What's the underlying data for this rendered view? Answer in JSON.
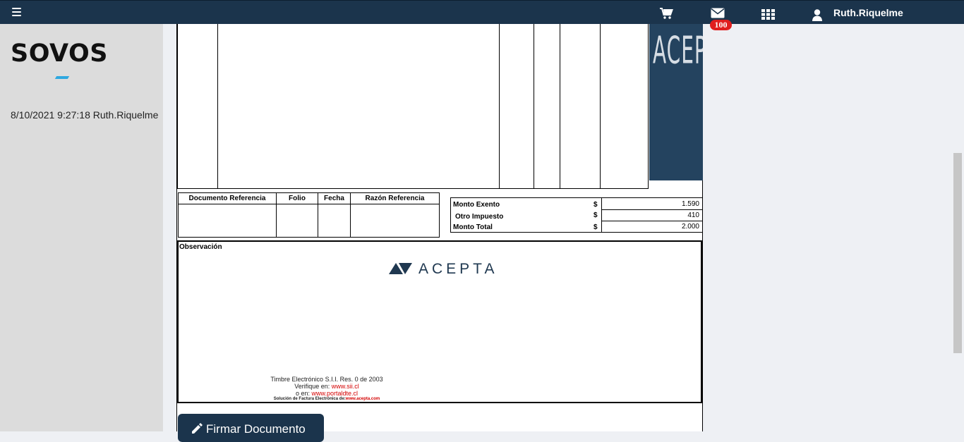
{
  "nav": {
    "user_name": "Ruth.Riquelme",
    "mail_count": "100",
    "icons": [
      "menu-icon",
      "cart-icon",
      "mail-icon",
      "apps-grid-icon",
      "user-icon"
    ]
  },
  "sidebar": {
    "logo": "SOVOS",
    "session_info": "8/10/2021 9:27:18 Ruth.Riquelme"
  },
  "document": {
    "banner_text": "ACEPTA",
    "references": {
      "headers": [
        "Documento Referencia",
        "Folio",
        "Fecha",
        "Razón Referencia"
      ]
    },
    "totals": [
      {
        "label": "Monto Exento",
        "currency": "$",
        "value": "1.590"
      },
      {
        "label": "Otro Impuesto",
        "currency": "$",
        "value": "410"
      },
      {
        "label": "Monto Total",
        "currency": "$",
        "value": "2.000"
      }
    ],
    "observacion_label": "Observación",
    "acepta_logo_text": "ACEPTA",
    "timbre": {
      "line1": "Timbre Electrónico S.I.I.  Res. 0 de 2003",
      "line2_prefix": "Verifique en: ",
      "line2_link": "www.sii.cl",
      "line3_prefix": "o en: ",
      "line3_link": "www.portaldte.cl",
      "line4_prefix": "Solución de Factura Electrónica de:",
      "line4_link": "www.acepta.com"
    }
  },
  "actions": {
    "sign_label": "Firmar Documento"
  },
  "colors": {
    "nav_bg": "#1b344c",
    "badge": "#e01e1e",
    "banner": "#24435f",
    "sovos_accent": "#2ea8e0"
  }
}
